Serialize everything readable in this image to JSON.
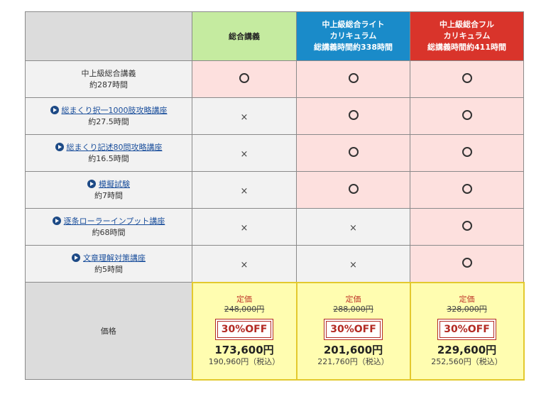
{
  "header": {
    "basic": "総合講義",
    "lite": {
      "line1": "中上級総合ライト",
      "line2": "カリキュラム",
      "line3": "総講義時間約338時間"
    },
    "full": {
      "line1": "中上級総合フル",
      "line2": "カリキュラム",
      "line3": "総講義時間約411時間"
    }
  },
  "rows": [
    {
      "name": "中上級総合講義",
      "hours": "約287時間",
      "link": false
    },
    {
      "name": "総まくり択一1000肢攻略講座",
      "hours": "約27.5時間",
      "link": true
    },
    {
      "name": "総まくり記述80問攻略講座",
      "hours": "約16.5時間",
      "link": true
    },
    {
      "name": "模擬試験",
      "hours": "約7時間",
      "link": true
    },
    {
      "name": "逐条ローラーインプット講座",
      "hours": "約68時間",
      "link": true
    },
    {
      "name": "文章理解対策講座",
      "hours": "約5時間",
      "link": true
    }
  ],
  "marks": {
    "circle": "○",
    "cross": "×"
  },
  "price": {
    "label": "価格",
    "teika": "定価",
    "discount": "30%OFF",
    "basic": {
      "orig": "248,000円",
      "main": "173,600円",
      "tax": "190,960円（税込）"
    },
    "lite": {
      "orig": "288,000円",
      "main": "201,600円",
      "tax": "221,760円（税込）"
    },
    "full": {
      "orig": "328,000円",
      "main": "229,600円",
      "tax": "252,560円（税込）"
    }
  }
}
